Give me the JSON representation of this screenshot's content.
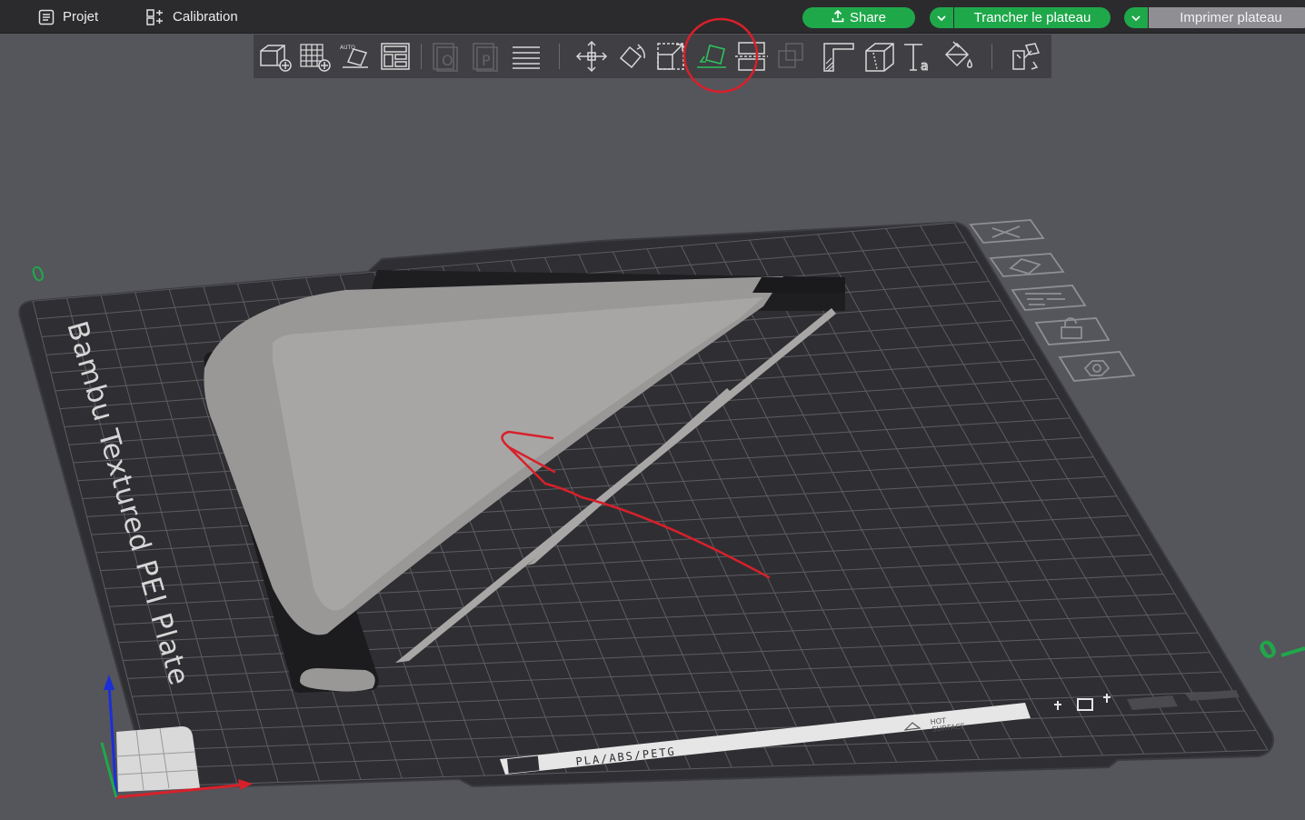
{
  "menu": {
    "project_label": "Projet",
    "calibration_label": "Calibration"
  },
  "actions": {
    "share_label": "Share",
    "slice_label": "Trancher le plateau",
    "print_label": "Imprimer plateau"
  },
  "toolbar": {
    "tools": [
      "add-object-icon",
      "add-plate-icon",
      "auto-orient-icon",
      "arrange-icon",
      "split-objects-icon",
      "split-parts-icon",
      "variable-layer-height-icon",
      "move-icon",
      "rotate-icon",
      "scale-icon",
      "lay-on-face-icon",
      "cut-icon",
      "mesh-boolean-icon",
      "support-painting-icon",
      "seam-painting-icon",
      "text-icon",
      "color-painting-icon",
      "assembly-view-icon"
    ],
    "highlighted_tool": "lay-on-face-icon"
  },
  "plate": {
    "name": "Bambu Textured PEI Plate",
    "filament_label": "PLA/ABS/PETG",
    "warning_line1": "HOT",
    "warning_line2": "SURFACE",
    "axis_label_y": "0",
    "axis_label_x": "0"
  },
  "plate_controls": [
    "close-plate-icon",
    "auto-orient-plate-icon",
    "arrange-plate-icon",
    "lock-plate-icon",
    "plate-settings-icon"
  ],
  "colors": {
    "accent_green": "#1fa84a",
    "annotation_red": "#d8202a",
    "plate_dark": "#2f2f33",
    "grid_line": "#5c5c62"
  }
}
